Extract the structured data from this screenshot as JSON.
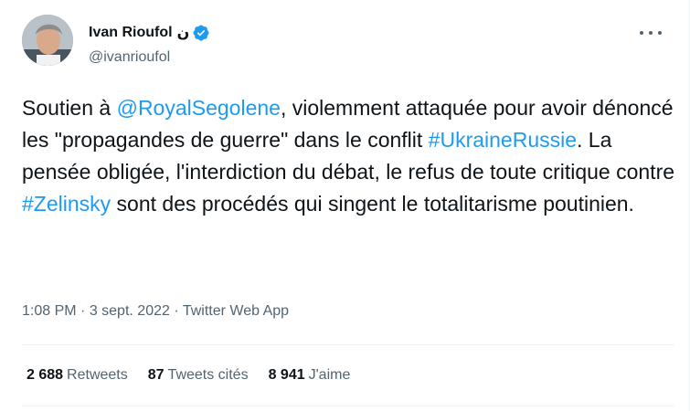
{
  "author": {
    "display_name": "Ivan Rioufol",
    "name_suffix": "ن",
    "handle": "@ivanrioufol",
    "avatar_icon": "profile-photo",
    "verified_icon": "verified-badge-icon"
  },
  "more_icon": "more-options-icon",
  "tweet": {
    "segments": [
      {
        "text": "Soutien à ",
        "link": false
      },
      {
        "text": "@RoyalSegolene",
        "link": true
      },
      {
        "text": ", violemment attaquée pour avoir dénoncé les \"propagandes de guerre\" dans le conflit ",
        "link": false
      },
      {
        "text": "#UkraineRussie",
        "link": true
      },
      {
        "text": ". La pensée obligée, l'interdiction du débat, le refus de toute critique contre ",
        "link": false
      },
      {
        "text": "#Zelinsky",
        "link": true
      },
      {
        "text": " sont des procédés qui singent le totalitarisme poutinien.",
        "link": false
      }
    ]
  },
  "meta": {
    "time": "1:08 PM",
    "separator": " · ",
    "date": "3 sept. 2022",
    "source": "Twitter Web App"
  },
  "stats": {
    "retweets_count": "2 688",
    "retweets_label": "Retweets",
    "quotes_count": "87",
    "quotes_label": "Tweets cités",
    "likes_count": "8 941",
    "likes_label": "J'aime"
  },
  "colors": {
    "link": "#1d9bf0",
    "secondary_text": "#536471",
    "primary_text": "#0f1419",
    "divider": "#eff3f4"
  }
}
